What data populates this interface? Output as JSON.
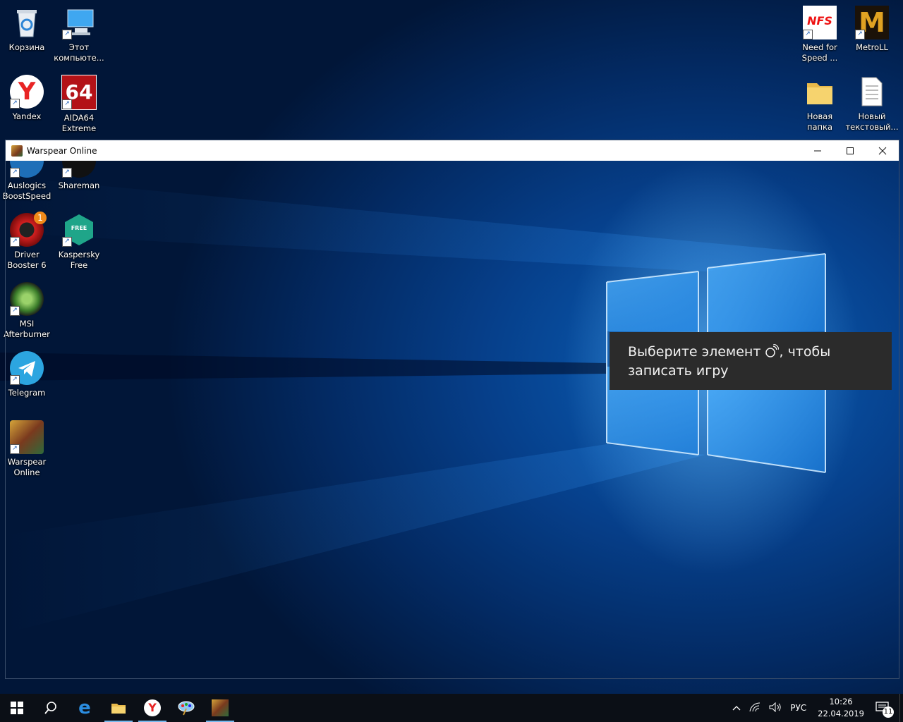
{
  "desktop": {
    "icons_left": [
      {
        "name": "recycle-bin",
        "label": "Корзина"
      },
      {
        "name": "this-pc",
        "label": "Этот\nкомпьюте..."
      },
      {
        "name": "yandex",
        "label": "Yandex"
      },
      {
        "name": "aida64",
        "label": "AIDA64\nExtreme"
      },
      {
        "name": "auslogics",
        "label": "Auslogics\nBoostSpeed"
      },
      {
        "name": "shareman",
        "label": "Shareman"
      },
      {
        "name": "driver-booster",
        "label": "Driver\nBooster 6",
        "badge": "1"
      },
      {
        "name": "kaspersky",
        "label": "Kaspersky\nFree",
        "badge_text": "FREE"
      },
      {
        "name": "msi-afterburner",
        "label": "MSI\nAfterburner"
      },
      {
        "name": "telegram",
        "label": "Telegram"
      },
      {
        "name": "warspear",
        "label": "Warspear\nOnline"
      }
    ],
    "icons_right": [
      {
        "name": "need-for-speed",
        "label": "Need for\nSpeed ...",
        "logo_text": "NFS"
      },
      {
        "name": "metroll",
        "label": "MetroLL",
        "logo_text": "M"
      },
      {
        "name": "new-folder",
        "label": "Новая папка"
      },
      {
        "name": "new-text-doc",
        "label": "Новый\nтекстовый..."
      }
    ],
    "aida_logo": "64",
    "yandex_logo": "Y"
  },
  "window": {
    "title": "Warspear Online",
    "min_icon": "minimize-icon",
    "max_icon": "maximize-icon",
    "close_icon": "close-icon"
  },
  "tooltip": {
    "text_before": "Выберите элемент",
    "text_after": ", чтобы записать игру",
    "icon": "game-record-icon"
  },
  "taskbar": {
    "apps": [
      "start",
      "search",
      "edge",
      "explorer",
      "yandex",
      "paint",
      "warspear"
    ],
    "language": "РУС",
    "time": "10:26",
    "date": "22.04.2019",
    "notifications_count": "11",
    "colors": {
      "accent": "#76b9ed",
      "bg": "#0b0f16"
    }
  }
}
